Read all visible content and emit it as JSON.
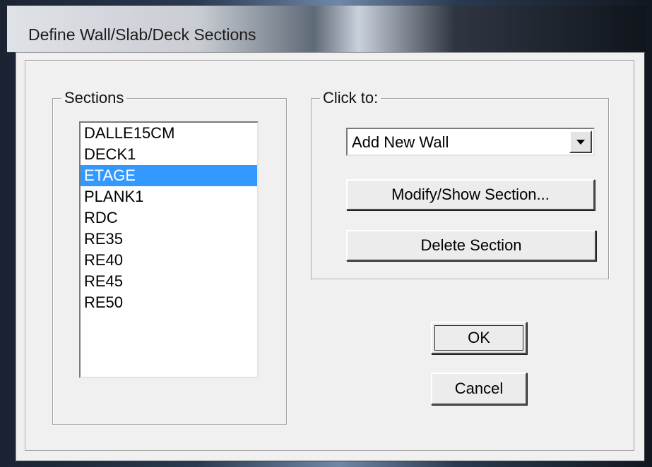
{
  "window": {
    "title": "Define Wall/Slab/Deck Sections"
  },
  "sections": {
    "label": "Sections",
    "items": [
      {
        "label": "DALLE15CM",
        "selected": false
      },
      {
        "label": "DECK1",
        "selected": false
      },
      {
        "label": "ETAGE",
        "selected": true
      },
      {
        "label": "PLANK1",
        "selected": false
      },
      {
        "label": "RDC",
        "selected": false
      },
      {
        "label": "RE35",
        "selected": false
      },
      {
        "label": "RE40",
        "selected": false
      },
      {
        "label": "RE45",
        "selected": false
      },
      {
        "label": "RE50",
        "selected": false
      }
    ]
  },
  "click_to": {
    "label": "Click to:",
    "dropdown_value": "Add New Wall",
    "modify_label": "Modify/Show Section...",
    "delete_label": "Delete Section"
  },
  "buttons": {
    "ok_label": "OK",
    "cancel_label": "Cancel"
  },
  "colors": {
    "selection": "#3399ff",
    "dialog_bg": "#f0f0f0"
  },
  "icons": {
    "dropdown": "chevron-down-icon"
  }
}
